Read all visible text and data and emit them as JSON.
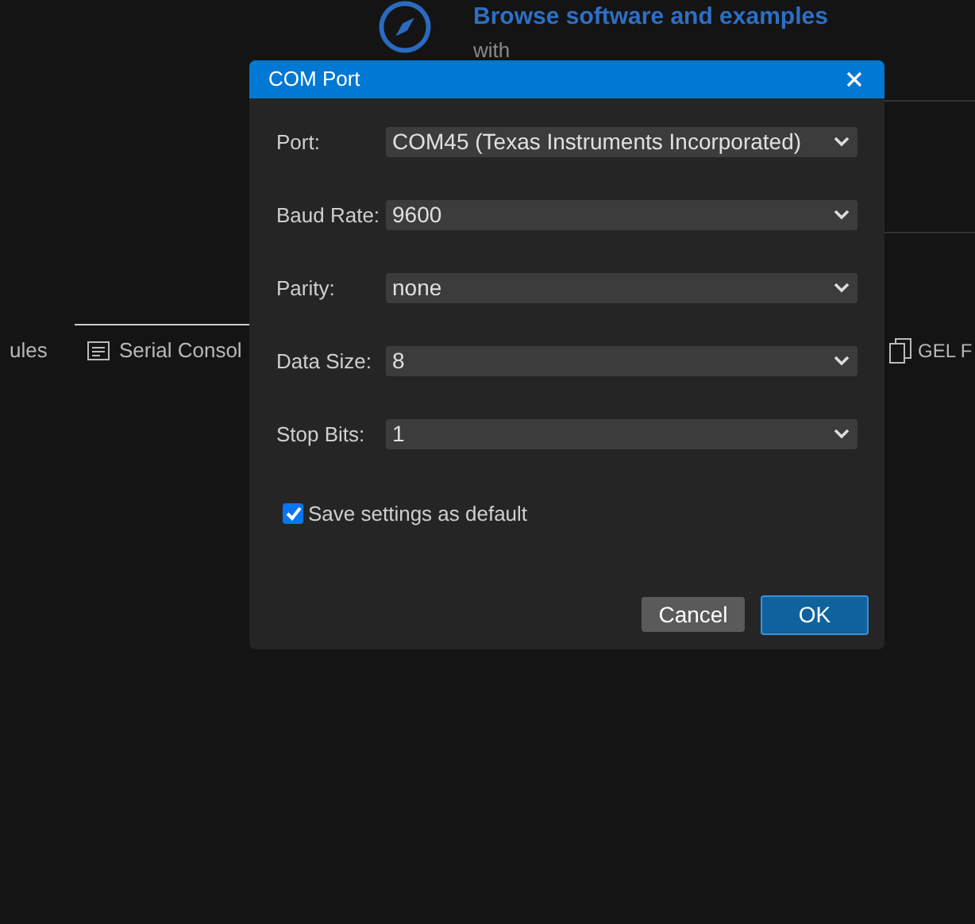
{
  "background": {
    "heading": "Browse software and examples",
    "subheading": "with",
    "tabs": [
      {
        "label": "ules",
        "kind": "plain",
        "selected": false
      },
      {
        "label": "Serial Consol",
        "kind": "console",
        "selected": true
      },
      {
        "label": "GEL F",
        "kind": "copy",
        "selected": false
      }
    ]
  },
  "dialog": {
    "title": "COM Port",
    "fields": [
      {
        "label": "Port:",
        "value": "COM45 (Texas Instruments Incorporated)"
      },
      {
        "label": "Baud Rate:",
        "value": "9600"
      },
      {
        "label": "Parity:",
        "value": "none"
      },
      {
        "label": "Data Size:",
        "value": "8"
      },
      {
        "label": "Stop Bits:",
        "value": "1"
      }
    ],
    "save_default": {
      "label": "Save settings as default",
      "checked": true
    },
    "buttons": [
      {
        "label": "Cancel",
        "kind": "secondary"
      },
      {
        "label": "OK",
        "kind": "primary"
      }
    ]
  }
}
